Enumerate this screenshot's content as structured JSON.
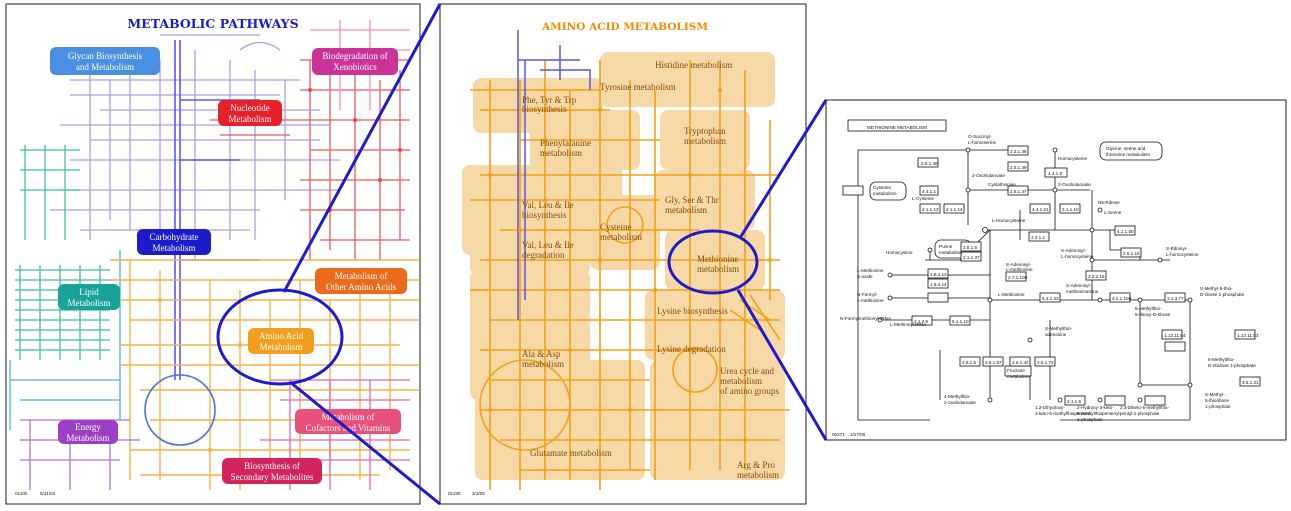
{
  "panels": {
    "overview": {
      "title": "METABOLIC PATHWAYS",
      "footer_id": "01100",
      "footer_date": "5/31/04",
      "categories": [
        {
          "label_l1": "Glycan Biosynthesis",
          "label_l2": "and Metabolism",
          "color": "#4a90e2"
        },
        {
          "label_l1": "Biodegradation of",
          "label_l2": "Xenobiotics",
          "color": "#cc3399"
        },
        {
          "label_l1": "Nucleotide",
          "label_l2": "Metabolism",
          "color": "#e8202a"
        },
        {
          "label_l1": "Carbohydrate",
          "label_l2": "Metabolism",
          "color": "#1c1ccc"
        },
        {
          "label_l1": "Lipid",
          "label_l2": "Metabolism",
          "color": "#17a39a"
        },
        {
          "label_l1": "Metabolism of",
          "label_l2": "Other Amino Acids",
          "color": "#ec6a1b"
        },
        {
          "label_l1": "Amino Acid",
          "label_l2": "Metabolism",
          "color": "#f19f1c"
        },
        {
          "label_l1": "Energy",
          "label_l2": "Metabolism",
          "color": "#9b3fc4"
        },
        {
          "label_l1": "Metabolism of",
          "label_l2": "Cofactors and Vitamins",
          "color": "#e8517c"
        },
        {
          "label_l1": "Biosynthesis of",
          "label_l2": "Secondary Metabolites",
          "color": "#d4245e"
        }
      ]
    },
    "amino": {
      "title": "AMINO ACID METABOLISM",
      "footer_id": "01150",
      "footer_date": "3/3/05",
      "regions": [
        "Histidine metabolism",
        "Tyrosine metabolism",
        "Phe, Tyr & Trp",
        "biosynthesis",
        "Phenylalanine",
        "metabolism",
        "Tryptophan",
        "metabolism",
        "Val, Leu & Ile",
        "biosynthesis",
        "Cysteine",
        "metabolism",
        "Gly, Ser & Thr",
        "metabolism",
        "Val, Leu & Ile",
        "degradation",
        "Methionine",
        "metabolism",
        "Lysine biosynthesis",
        "Ala & Asp",
        "metabolism",
        "Lysine degradation",
        "Urea cycle and",
        "metabolism",
        "of amino groups",
        "Glutamate metabolism",
        "Arg & Pro",
        "metabolism"
      ]
    },
    "methionine": {
      "title": "METHIONINE METABOLISM",
      "footer_id": "00271",
      "footer_date": "1/27/06",
      "compounds": [
        "O-Succinyl-",
        "L-homoserine",
        "Glycine, serine and",
        "threonine metabolism",
        "2-Oxobutanoate",
        "Cystathionine",
        "Cysteine",
        "metabolism",
        "L-Cysteine",
        "2-Oxobutanoate",
        "Homocysteine",
        "L-Serine",
        "L-Homocysteine",
        "N5-Ribose",
        "Purine",
        "metabolism",
        "S-Adenosyl-",
        "L-homocysteine",
        "S-Ribosyl-",
        "L-homocysteine",
        "Homocystine",
        "L-Methionine",
        "S-Adenosyl-",
        "L-methionine",
        "L-Methionine",
        "S-oxide",
        "N-Formyl-",
        "L-methionine",
        "S-Adenosyl-",
        "methioninamine",
        "5-Methylthio-",
        "5-deoxy-D-ribose",
        "N-Formylmethionyl-tRNA",
        "L-Methionyl-tRNA",
        "S-Methyl-5-thio-",
        "D-ribose 1-phosphate",
        "5-Methylthio-",
        "D-ribulose 1-phosphate",
        "4-Methylthio-",
        "2-oxobutanoate",
        "2-Hydroxy-3-keto-",
        "5-methylthiopentenyl-",
        "1-phosphate",
        "2,3-Diketo-5-methylthio-",
        "pentyl-1-phosphate",
        "1,2-Dihydroxy-",
        "3-keto-5-methylthiopentene",
        "S-Methyl-",
        "5-thioribose",
        "1-phosphate",
        "Fructose",
        "metabolism",
        "S-Methylthio-",
        "adenosine"
      ],
      "enzymes": [
        "2.5.1.48",
        "2.3.1.46",
        "4.4.1.1",
        "2.5.1.49",
        "2.5.1.47",
        "4.4.1.8",
        "4.4.1.21",
        "2.1.1.10",
        "2.1.1.13",
        "2.1.1.14",
        "3.3.1.1",
        "2.5.1.6",
        "2.1.1.37",
        "4.1.1.50",
        "2.5.1.16",
        "1.8.4.13",
        "1.8.4.14",
        "2.1.2.9",
        "6.1.1.10",
        "2.7.1.100",
        "3.2.2.16",
        "5.3.1.23",
        "4.2.1.109",
        "3.1.3.77",
        "1.13.11.54",
        "1.13.11.53",
        "2.6.1.5",
        "2.6.1.57",
        "2.6.1.42",
        "2.6.1.72",
        "3.5.1.31",
        "2.1.1.5"
      ]
    }
  }
}
